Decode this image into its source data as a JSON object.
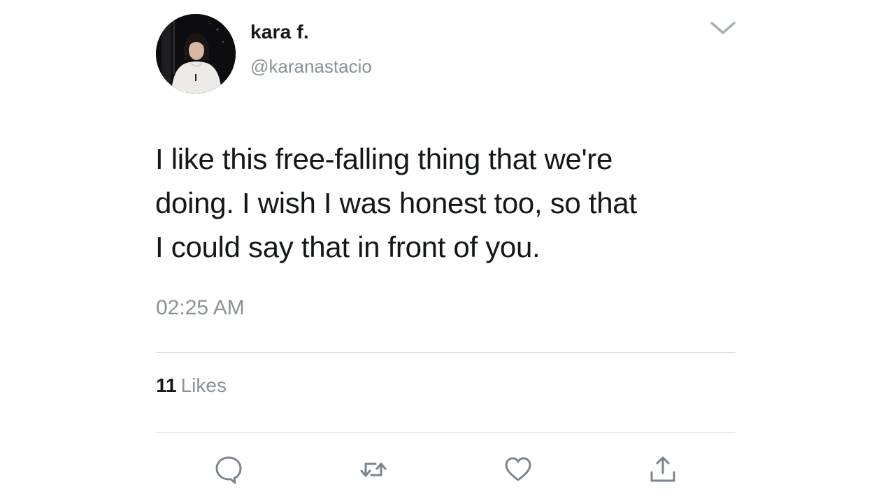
{
  "tweet": {
    "author": {
      "display_name": "kara f.",
      "handle": "@karanastacio",
      "avatar_icon": "profile-photo"
    },
    "text_lines": [
      "I like this free-falling thing that we're",
      "doing. I wish I was honest too, so that",
      "I could say that in front of you."
    ],
    "timestamp": "02:25 AM",
    "likes": {
      "count": "11",
      "label": "Likes"
    },
    "actions": [
      {
        "name": "reply",
        "icon": "comment-bubble-icon"
      },
      {
        "name": "retweet",
        "icon": "retweet-icon"
      },
      {
        "name": "like",
        "icon": "heart-icon"
      },
      {
        "name": "share",
        "icon": "share-icon"
      }
    ],
    "menu_icon": "chevron-down-icon"
  },
  "colors": {
    "text_primary": "#14171a",
    "text_secondary": "#8b9298",
    "divider": "#d8dde1",
    "icon": "#7a858f"
  }
}
